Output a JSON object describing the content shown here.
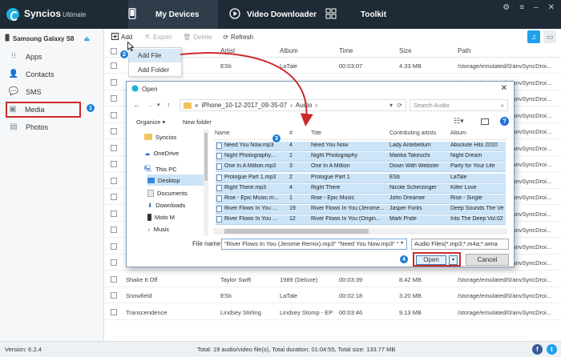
{
  "app": {
    "name": "Syncios",
    "edition": "Ultimate",
    "tabs": [
      {
        "label": "My Devices"
      },
      {
        "label": "Video Downloader"
      },
      {
        "label": "Toolkit"
      }
    ]
  },
  "device": {
    "name": "Samsung Galaxy S8"
  },
  "sidebar": {
    "items": [
      {
        "label": "Apps"
      },
      {
        "label": "Contacts"
      },
      {
        "label": "SMS"
      },
      {
        "label": "Media"
      },
      {
        "label": "Photos"
      }
    ]
  },
  "toolbar": {
    "add": "Add",
    "export": "Export",
    "delete": "Delete",
    "refresh": "Refresh"
  },
  "add_menu": {
    "items": [
      {
        "label": "Add File"
      },
      {
        "label": "Add Folder"
      }
    ]
  },
  "table": {
    "headers": [
      "Artist",
      "Album",
      "Time",
      "Size",
      "Path"
    ],
    "rows": [
      {
        "title": "",
        "artist": "ESti",
        "album": "LaTale",
        "time": "00:03:07",
        "size": "4.33 MB",
        "path": "/storage/emulated/0/anvSyncDroi..."
      },
      {
        "title": "",
        "artist": "",
        "album": "",
        "time": "",
        "size": "",
        "path": "/storage/emulated/0/anvSyncDroi..."
      },
      {
        "title": "",
        "artist": "",
        "album": "",
        "time": "",
        "size": "",
        "path": "/storage/emulated/0/anvSyncDroi..."
      },
      {
        "title": "",
        "artist": "",
        "album": "",
        "time": "",
        "size": "",
        "path": "/storage/emulated/0/anvSyncDroi..."
      },
      {
        "title": "",
        "artist": "",
        "album": "",
        "time": "",
        "size": "",
        "path": "/storage/emulated/0/anvSyncDroi..."
      },
      {
        "title": "",
        "artist": "",
        "album": "",
        "time": "",
        "size": "",
        "path": "/storage/emulated/0/anvSyncDroi..."
      },
      {
        "title": "",
        "artist": "",
        "album": "",
        "time": "",
        "size": "",
        "path": "/storage/emulated/0/anvSyncDroi..."
      },
      {
        "title": "",
        "artist": "",
        "album": "",
        "time": "",
        "size": "",
        "path": "/storage/emulated/0/anvSyncDroi..."
      },
      {
        "title": "",
        "artist": "",
        "album": "",
        "time": "",
        "size": "",
        "path": "/storage/emulated/0/anvSyncDroi..."
      },
      {
        "title": "",
        "artist": "",
        "album": "",
        "time": "",
        "size": "",
        "path": "/storage/emulated/0/anvSyncDroi..."
      },
      {
        "title": "",
        "artist": "",
        "album": "",
        "time": "",
        "size": "",
        "path": "/storage/emulated/0/anvSyncDroi..."
      },
      {
        "title": "",
        "artist": "",
        "album": "",
        "time": "",
        "size": "",
        "path": "/storage/emulated/0/anvSyncDroi..."
      },
      {
        "title": "",
        "artist": "",
        "album": "",
        "time": "",
        "size": "",
        "path": "/storage/emulated/0/anvSyncDroi..."
      },
      {
        "title": "Shake It Off",
        "artist": "Taylor Swift",
        "album": "1989 (Deluxe)",
        "time": "00:03:39",
        "size": "8.42 MB",
        "path": "/storage/emulated/0/anvSyncDroi..."
      },
      {
        "title": "Snowfield",
        "artist": "ESti",
        "album": "LaTale",
        "time": "00:02:18",
        "size": "3.20 MB",
        "path": "/storage/emulated/0/anvSyncDroi..."
      },
      {
        "title": "Transcendence",
        "artist": "Lindsey Stirling",
        "album": "Lindsey Stomp - EP",
        "time": "00:03:46",
        "size": "9.13 MB",
        "path": "/storage/emulated/0/anvSyncDroi..."
      }
    ]
  },
  "status": {
    "version": "Version: 6.2.4",
    "summary": "Total: 19 audio/video file(s), Total duration: 01:04:55, Total size: 133.77 MB"
  },
  "dialog": {
    "title": "Open",
    "breadcrumb": [
      "«",
      "iPhone_10-12-2017_09-35-07",
      "›",
      "Audio",
      "›"
    ],
    "search_placeholder": "Search Audio",
    "organize": "Organize ▾",
    "new_folder": "New folder",
    "tree": [
      "Syncios",
      "OneDrive",
      "This PC",
      "Desktop",
      "Documents",
      "Downloads",
      "Moto M",
      "Music"
    ],
    "columns": [
      "Name",
      "#",
      "Title",
      "Contributing artists",
      "Album"
    ],
    "files": [
      {
        "name": "Need You Now.mp3",
        "num": "4",
        "title": "Need You Now",
        "artist": "Lady Antebellum",
        "album": "Absolute Hits 2010"
      },
      {
        "name": "Night Photography...",
        "num": "1",
        "title": "Night Photography",
        "artist": "Marika Takeuchi",
        "album": "Night Dream"
      },
      {
        "name": "One In A Million.mp3",
        "num": "3",
        "title": "One In A Million",
        "artist": "Down With Webster",
        "album": "Party for Your Life"
      },
      {
        "name": "Prologue Part 1.mp3",
        "num": "2",
        "title": "Prologue Part 1",
        "artist": "ESti",
        "album": "LaTale"
      },
      {
        "name": "Right There.mp3",
        "num": "4",
        "title": "Right There",
        "artist": "Nicole Scherzinger",
        "album": "Killer Love"
      },
      {
        "name": "Rise - Epic Music.m...",
        "num": "1",
        "title": "Rise - Epic Music",
        "artist": "John Dreamer",
        "album": "Rise - Single"
      },
      {
        "name": "River Flows In You ...",
        "num": "19",
        "title": "River Flows In You (Jerome...",
        "artist": "Jasper Forks",
        "album": "Deep Sounds The Ve"
      },
      {
        "name": "River Flows In You ...",
        "num": "12",
        "title": "River Flows In You (Origin...",
        "artist": "Mark Pride",
        "album": "Into The Deep Vol.02"
      }
    ],
    "filename_label": "File name:",
    "filename_value": "\"River Flows In You (Jerome Remix).mp3\" \"Need You Now.mp3\" \"",
    "filetype_value": "Audio Files(*.mp3;*.m4a;*.wma",
    "open_label": "Open",
    "cancel_label": "Cancel"
  },
  "steps": [
    "1",
    "2",
    "3",
    "4"
  ],
  "colors": {
    "topbar": "#1e2a35",
    "accent": "#1fa0e8",
    "highlight_red": "#cc2a2a",
    "selection": "#cce4f7",
    "step_badge": "#1f7fd6"
  }
}
